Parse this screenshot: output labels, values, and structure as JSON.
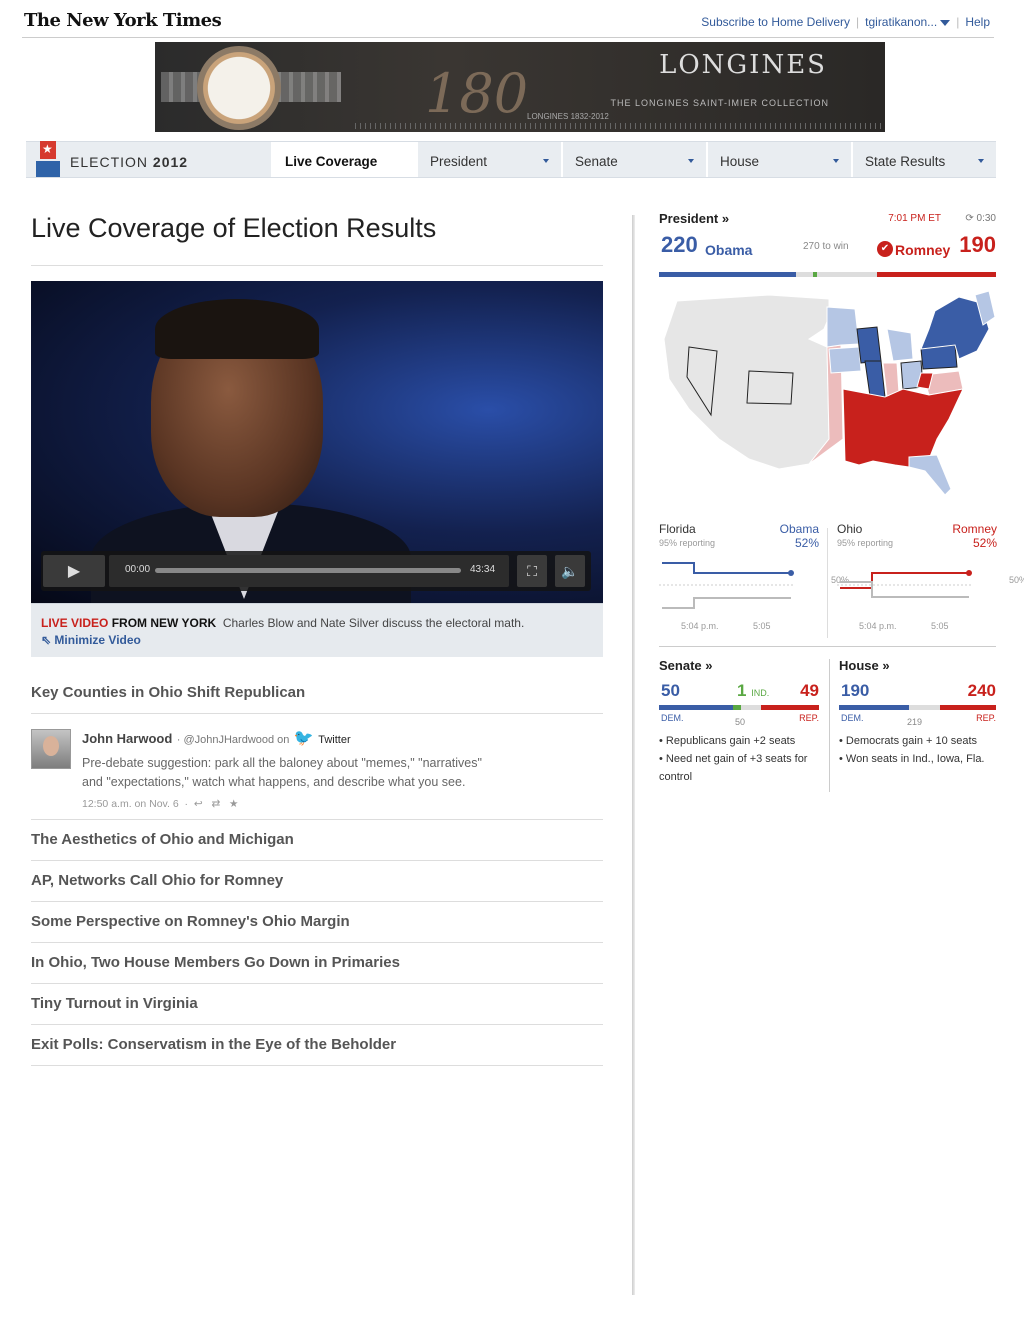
{
  "header": {
    "logo": "The New York Times",
    "subscribe": "Subscribe to Home Delivery",
    "user": "tgiratikanon...",
    "help": "Help"
  },
  "ad": {
    "brand": "LONGINES",
    "anniversary": "180",
    "years": "LONGINES 1832-2012",
    "collection": "THE LONGINES SAINT-IMIER COLLECTION"
  },
  "nav": {
    "election_label": "ELECTION",
    "election_year": "2012",
    "tabs": [
      {
        "label": "Live Coverage",
        "active": true,
        "dropdown": false
      },
      {
        "label": "President",
        "active": false,
        "dropdown": true
      },
      {
        "label": "Senate",
        "active": false,
        "dropdown": true
      },
      {
        "label": "House",
        "active": false,
        "dropdown": true
      },
      {
        "label": "State Results",
        "active": false,
        "dropdown": true
      }
    ]
  },
  "main": {
    "title": "Live Coverage of Election Results",
    "video": {
      "time_current": "00:00",
      "time_total": "43:34",
      "live": "LIVE VIDEO",
      "from": "FROM NEW YORK",
      "caption": "Charles Blow and Nate Silver discuss the electoral math.",
      "minimize": "Minimize Video"
    },
    "headlines_top": [
      "Key Counties in Ohio Shift Republican"
    ],
    "tweet": {
      "author": "John Harwood",
      "handle": "@JohnJHardwood on",
      "service": "Twitter",
      "text": "Pre-debate suggestion: park all the baloney about \"memes,\" \"narratives\" and \"expectations,\" watch what happens, and describe what you see.",
      "time": "12:50 a.m. on Nov. 6"
    },
    "headlines": [
      "The Aesthetics of Ohio and Michigan",
      "AP, Networks Call Ohio for Romney",
      "Some Perspective on Romney's Ohio Margin",
      "In Ohio, Two House Members Go Down in Primaries",
      "Tiny Turnout in Virginia",
      "Exit Polls: Conservatism in the Eye of the Beholder"
    ]
  },
  "president": {
    "heading": "President »",
    "time": "7:01 PM ET",
    "refresh": "0:30",
    "obama_ev": "220",
    "obama": "Obama",
    "to_win": "270 to win",
    "romney": "Romney",
    "romney_ev": "190",
    "obama_share": 0.4074,
    "romney_share": 0.3519,
    "colors": {
      "dem": "#3a5da6",
      "dem_lean": "#b5c6e4",
      "rep": "#c8211c",
      "rep_lean": "#ecbcbc",
      "neutral": "#e4e4e4"
    }
  },
  "races": [
    {
      "state": "Florida",
      "reporting": "95% reporting",
      "leader": "Obama",
      "pct": "52%",
      "party": "dem",
      "mid": "50%",
      "t1": "5:04 p.m.",
      "t2": "5:05"
    },
    {
      "state": "Ohio",
      "reporting": "95% reporting",
      "leader": "Romney",
      "pct": "52%",
      "party": "rep",
      "mid": "50%",
      "t1": "5:04 p.m.",
      "t2": "5:05"
    }
  ],
  "senate": {
    "heading": "Senate »",
    "dem": "50",
    "ind": "1",
    "ind_label": "IND.",
    "rep": "49",
    "dem_label": "DEM.",
    "rep_label": "REP.",
    "mark": "50",
    "notes": [
      "• Republicans gain +2 seats",
      "• Need net gain of +3 seats for control"
    ]
  },
  "house": {
    "heading": "House »",
    "dem": "190",
    "rep": "240",
    "dem_label": "DEM.",
    "rep_label": "REP.",
    "mark": "219",
    "notes": [
      "• Democrats gain + 10 seats",
      "• Won seats in Ind., Iowa, Fla."
    ]
  }
}
